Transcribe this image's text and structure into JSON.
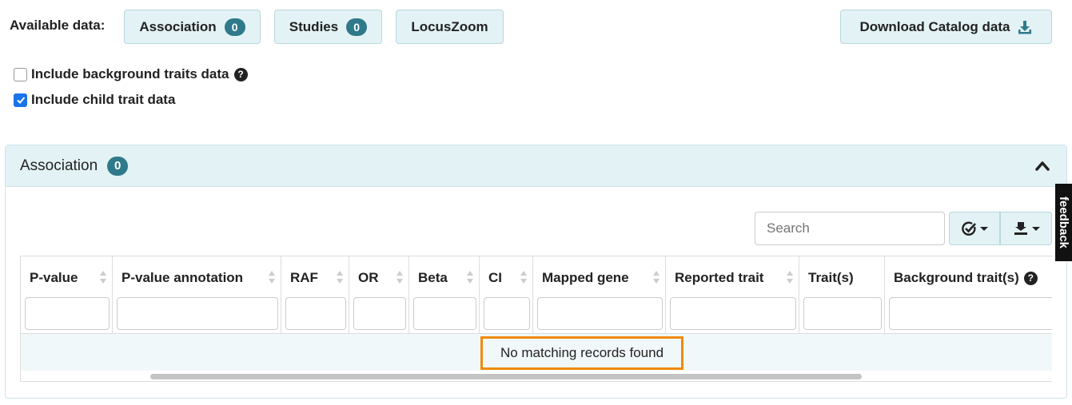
{
  "available_data": {
    "label": "Available data:",
    "buttons": [
      {
        "label": "Association",
        "count": "0"
      },
      {
        "label": "Studies",
        "count": "0"
      },
      {
        "label": "LocusZoom"
      }
    ],
    "download_label": "Download Catalog data"
  },
  "options": {
    "background_traits": {
      "label": "Include background traits data",
      "checked": false
    },
    "child_traits": {
      "label": "Include child trait data",
      "checked": true
    }
  },
  "panel": {
    "title": "Association",
    "count": "0"
  },
  "table": {
    "search_placeholder": "Search",
    "columns": [
      "P-value",
      "P-value annotation",
      "RAF",
      "OR",
      "Beta",
      "CI",
      "Mapped gene",
      "Reported trait",
      "Trait(s)",
      "Background trait(s)"
    ],
    "empty_message": "No matching records found"
  },
  "feedback_label": "feedback",
  "colors": {
    "accent_bg": "#e3f2f5",
    "badge": "#2f7a8a",
    "highlight": "#f08a0c",
    "checkbox": "#1a73e8"
  }
}
